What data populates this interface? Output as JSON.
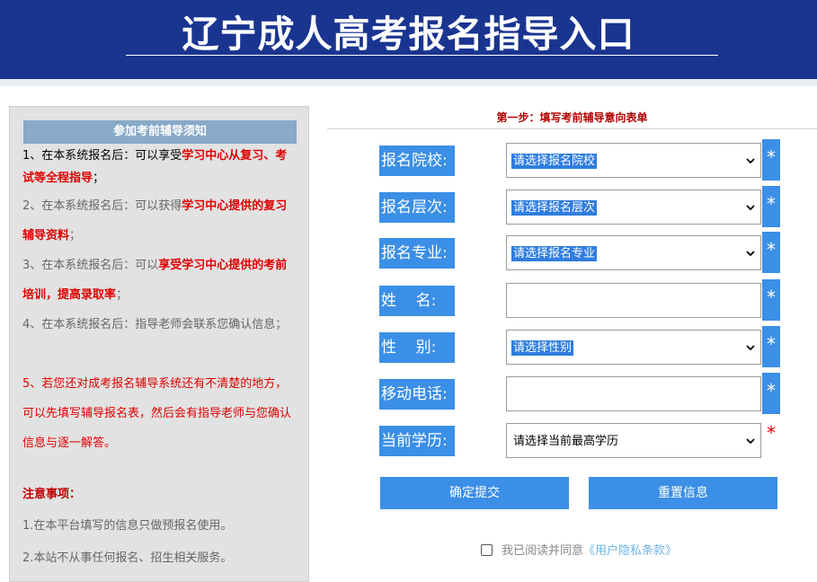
{
  "header": {
    "title": "辽宁成人高考报名指导入口"
  },
  "sidebar": {
    "heading": "参加考前辅导须知",
    "notice1": {
      "prefix": "1、在本系统报名后：可以享受",
      "highlight": "学习中心从复习、考试等全程指导",
      "suffix": "；"
    },
    "notice2": {
      "prefix": "2、在本系统报名后：可以获得",
      "highlight": "学习中心提供的复习辅导资料",
      "suffix": "；"
    },
    "notice3": {
      "prefix": "3、在本系统报名后：可以",
      "highlight": "享受学习中心提供的考前培训，提高录取率",
      "suffix": "；"
    },
    "notice4": {
      "text": "4、在本系统报名后：指导老师会联系您确认信息；"
    },
    "notice5": {
      "text": "5、若您还对成考报名辅导系统还有不清楚的地方，可以先填写辅导报名表，然后会有指导老师与您确认信息与逐一解答。"
    },
    "attention_title": "注意事项：",
    "attention1": "1.在本平台填写的信息只做预报名使用。",
    "attention2": "2.本站不从事任何报名、招生相关服务。"
  },
  "form": {
    "step_title": "第一步：填写考前辅导意向表单",
    "school_label": "报名院校:",
    "school_value": "请选择报名院校",
    "level_label": "报名层次:",
    "level_value": "请选择报名层次",
    "major_label": "报名专业:",
    "major_value": "请选择报名专业",
    "name_label": "姓    名:",
    "name_value": "",
    "gender_label": "性    别:",
    "gender_value": "请选择性别",
    "phone_label": "移动电话:",
    "phone_value": "",
    "edu_label": "当前学历:",
    "edu_value": "请选择当前最高学历",
    "required_mark": "*",
    "submit_label": "确定提交",
    "reset_label": "重置信息",
    "agree_text": "我已阅读并同意",
    "agree_link": "《用户隐私条款》"
  },
  "colors": {
    "header_bg": "#1a3590",
    "accent": "#3b8fe6",
    "notice_red": "#e00000"
  },
  "icons": {
    "select_arrow": "chevron-down-icon"
  }
}
